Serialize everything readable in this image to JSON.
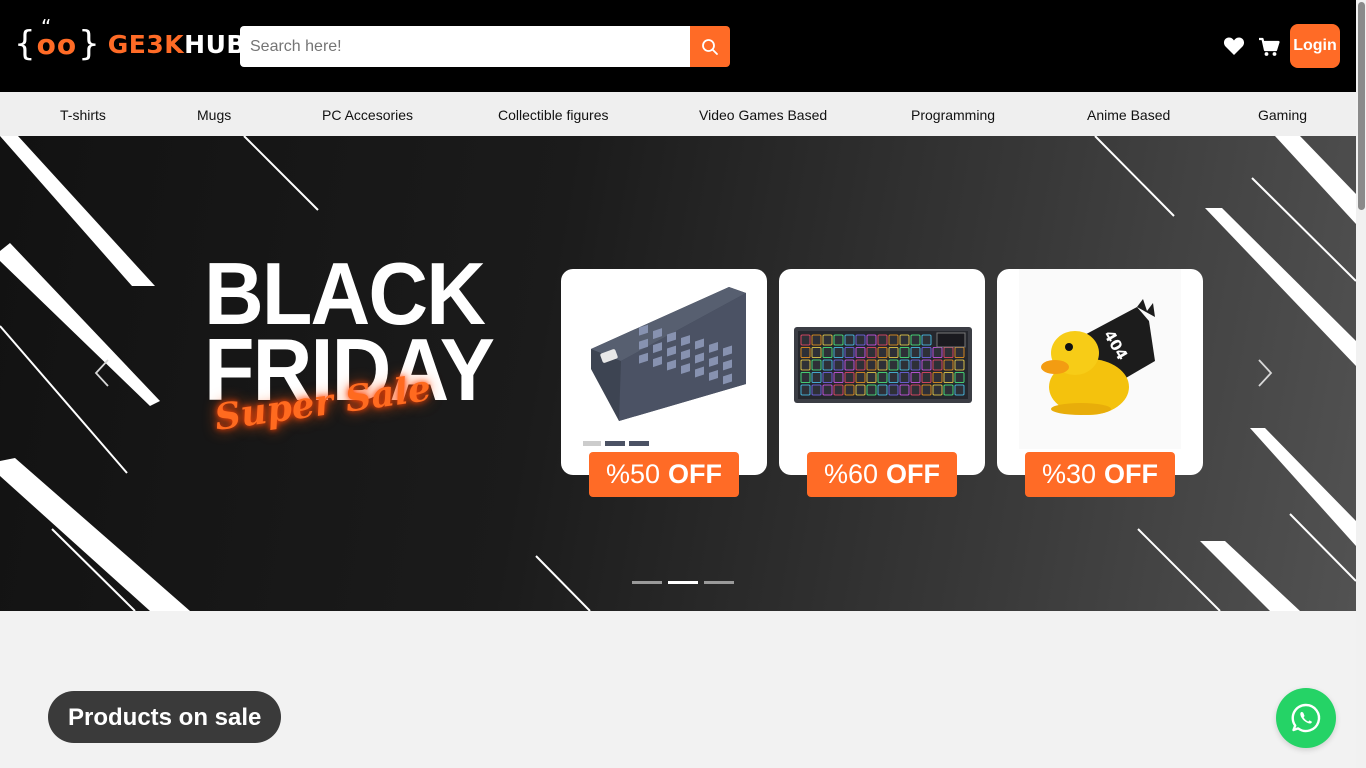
{
  "header": {
    "logo": {
      "brace_open": "{",
      "eyes": "oo",
      "quote": "“",
      "brace_close": "}",
      "name_accent": "GE3K",
      "name_rest": "HUB"
    },
    "search": {
      "placeholder": "Search here!",
      "value": "",
      "button_icon": "search-icon"
    },
    "icons": {
      "wishlist": "heart-icon",
      "cart": "cart-icon"
    },
    "login_label": "Login"
  },
  "categories": [
    "T-shirts",
    "Mugs",
    "PC Accesories",
    "Collectible figures",
    "Video Games Based",
    "Programming",
    "Anime Based",
    "Gaming"
  ],
  "hero": {
    "headline_line1": "BLACK",
    "headline_line2": "FRIDAY",
    "headline_script": "Super Sale",
    "offers": [
      {
        "percent": "%50",
        "label": "OFF",
        "product": "keyboard"
      },
      {
        "percent": "%60",
        "label": "OFF",
        "product": "rgb-keyboard"
      },
      {
        "percent": "%30",
        "label": "OFF",
        "product": "rubber-duck-404"
      }
    ],
    "carousel": {
      "slides": 3,
      "active_index": 1
    }
  },
  "main": {
    "section_title": "Products on sale"
  },
  "colors": {
    "accent": "#ff6b26",
    "header_bg": "#000000",
    "nav_bg": "#efefef",
    "page_bg": "#f2f2f2",
    "whatsapp": "#25d366"
  }
}
